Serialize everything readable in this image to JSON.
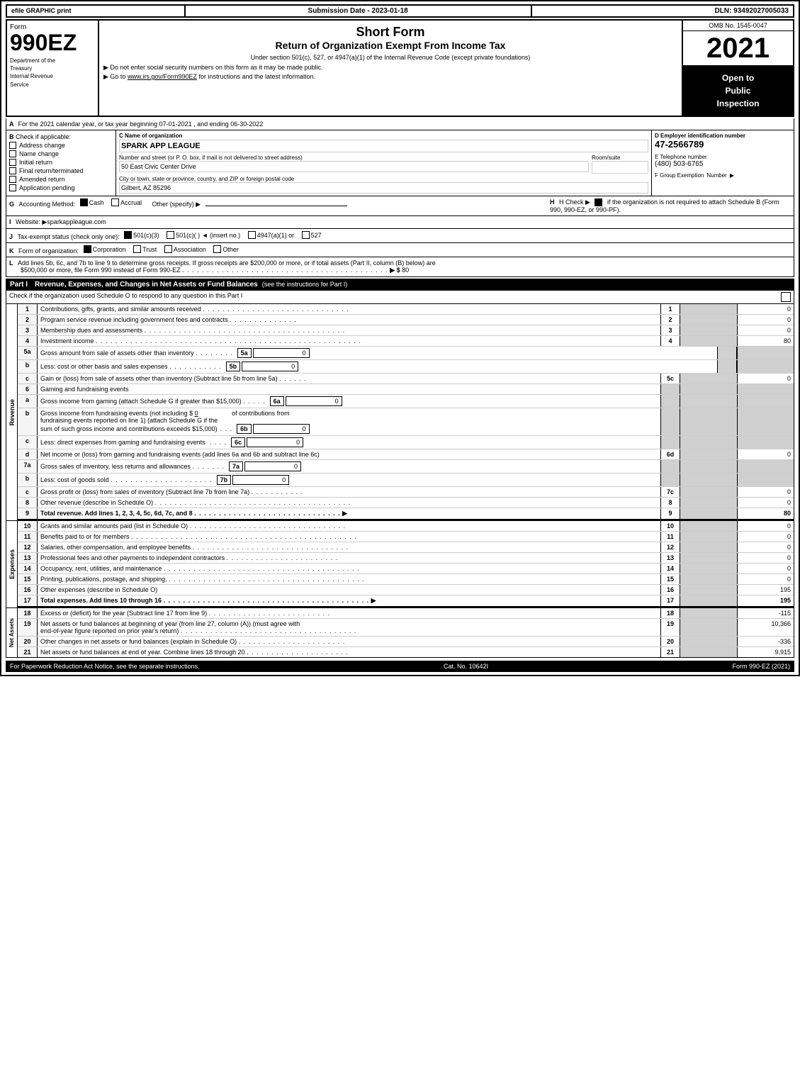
{
  "header": {
    "efile_label": "efile GRAPHIC print",
    "submission_label": "Submission Date - 2023-01-18",
    "dln_label": "DLN: 93492027005033",
    "form_number": "990EZ",
    "form_dept1": "Department of the",
    "form_dept2": "Treasury",
    "form_dept3": "Internal Revenue",
    "form_dept4": "Service",
    "short_form": "Short Form",
    "return_title": "Return of Organization Exempt From Income Tax",
    "under_section": "Under section 501(c), 527, or 4947(a)(1) of the Internal Revenue Code (except private foundations)",
    "do_not_enter": "▶ Do not enter social security numbers on this form as it may be made public.",
    "goto": "▶ Go to www.irs.gov/Form990EZ for instructions and the latest information.",
    "goto_url": "www.irs.gov/Form990EZ",
    "omb": "OMB No. 1545-0047",
    "year": "2021",
    "open_to_public": "Open to\nPublic\nInspection"
  },
  "section_a": {
    "label": "A",
    "text": "For the 2021 calendar year, or tax year beginning 07-01-2021 , and ending 06-30-2022"
  },
  "section_b": {
    "label": "B",
    "check_label": "Check if applicable:",
    "checkboxes": [
      {
        "label": "Address change",
        "checked": false
      },
      {
        "label": "Name change",
        "checked": false
      },
      {
        "label": "Initial return",
        "checked": false
      },
      {
        "label": "Final return/terminated",
        "checked": false
      },
      {
        "label": "Amended return",
        "checked": false
      },
      {
        "label": "Application pending",
        "checked": false
      }
    ],
    "c_label": "C Name of organization",
    "org_name": "SPARK APP LEAGUE",
    "address_label": "Number and street (or P. O. box, if mail is not delivered to street address)",
    "address_value": "50 East Civic Center Drive",
    "room_label": "Room/suite",
    "city_label": "City or town, state or province, country, and ZIP or foreign postal code",
    "city_value": "Gilbert, AZ  85296",
    "d_label": "D Employer identification number",
    "ein": "47-2566789",
    "e_label": "E Telephone number",
    "phone": "(480) 503-6765",
    "f_label": "F Group Exemption",
    "f_label2": "Number",
    "f_arrow": "▶"
  },
  "section_g": {
    "label": "G",
    "text": "Accounting Method:",
    "cash_label": "Cash",
    "cash_checked": true,
    "accrual_label": "Accrual",
    "accrual_checked": false,
    "other_label": "Other (specify) ▶",
    "h_text": "H  Check ▶",
    "h_checked": true,
    "h_detail": "if the organization is not required to attach Schedule B (Form 990, 990-EZ, or 990-PF)."
  },
  "section_i": {
    "label": "I",
    "text": "Website: ▶sparkappleague.com"
  },
  "section_j": {
    "label": "J",
    "text": "Tax-exempt status (check only one):",
    "options": [
      {
        "label": "501(c)(3)",
        "checked": true
      },
      {
        "label": "501(c)(  )  ◄ (insert no.)",
        "checked": false
      },
      {
        "label": "4947(a)(1) or",
        "checked": false
      },
      {
        "label": "527",
        "checked": false
      }
    ]
  },
  "section_k": {
    "label": "K",
    "text": "Form of organization:",
    "options": [
      {
        "label": "Corporation",
        "checked": true
      },
      {
        "label": "Trust",
        "checked": false
      },
      {
        "label": "Association",
        "checked": false
      },
      {
        "label": "Other",
        "checked": false
      }
    ]
  },
  "section_l": {
    "label": "L",
    "text1": "Add lines 5b, 6c, and 7b to line 9 to determine gross receipts. If gross receipts are $200,000 or more, or if total assets (Part II, column (B) below) are",
    "text2": "$500,000 or more, file Form 990 instead of Form 990-EZ",
    "dots": ". . . . . . . . . . . . . . . . . . . . . . . . . . . . . . . . . . . . .",
    "arrow": "▶ $",
    "value": "80"
  },
  "part1": {
    "title": "Part I",
    "subtitle": "Revenue, Expenses, and Changes in Net Assets or Fund Balances",
    "see_instructions": "(see the instructions for Part I)",
    "check_label": "Check if the organization used Schedule O to respond to any question in this Part I",
    "rows": [
      {
        "num": "1",
        "desc": "Contributions, gifts, grants, and similar amounts received",
        "dots": true,
        "col_num": "1",
        "value": "0"
      },
      {
        "num": "2",
        "desc": "Program service revenue including government fees and contracts",
        "dots": true,
        "col_num": "2",
        "value": "0"
      },
      {
        "num": "3",
        "desc": "Membership dues and assessments",
        "dots": true,
        "col_num": "3",
        "value": "0"
      },
      {
        "num": "4",
        "desc": "Investment income",
        "dots": true,
        "col_num": "4",
        "value": "80"
      },
      {
        "num": "5a",
        "desc": "Gross amount from sale of assets other than inventory",
        "sub_ref": "5a",
        "sub_val": "0",
        "col_num": "",
        "value": ""
      },
      {
        "num": "5b",
        "desc": "Less: cost or other basis and sales expenses",
        "sub_ref": "5b",
        "sub_val": "0",
        "col_num": "",
        "value": ""
      },
      {
        "num": "5c",
        "desc": "Gain or (loss) from sale of assets other than inventory (Subtract line 5b from line 5a)",
        "dots": true,
        "col_num": "5c",
        "value": "0"
      },
      {
        "num": "6",
        "desc": "Gaming and fundraising events",
        "col_num": "",
        "value": ""
      },
      {
        "num": "6a",
        "desc": "Gross income from gaming (attach Schedule G if greater than $15,000)",
        "sub_ref": "6a",
        "sub_val": "0",
        "col_num": "",
        "value": ""
      },
      {
        "num": "6b",
        "desc": "Gross income from fundraising events (not including $ 0 of contributions from fundraising events reported on line 1) (attach Schedule G if the sum of such gross income and contributions exceeds $15,000)",
        "sub_ref": "6b",
        "sub_val": "0",
        "col_num": "",
        "value": ""
      },
      {
        "num": "6c",
        "desc": "Less: direct expenses from gaming and fundraising events",
        "sub_ref": "6c",
        "sub_val": "0",
        "col_num": "",
        "value": ""
      },
      {
        "num": "6d",
        "desc": "Net income or (loss) from gaming and fundraising events (add lines 6a and 6b and subtract line 6c)",
        "col_num": "6d",
        "value": "0"
      },
      {
        "num": "7a",
        "desc": "Gross sales of inventory, less returns and allowances",
        "dots": true,
        "sub_ref": "7a",
        "sub_val": "0",
        "col_num": "",
        "value": ""
      },
      {
        "num": "7b",
        "desc": "Less: cost of goods sold",
        "dots": true,
        "sub_ref": "7b",
        "sub_val": "0",
        "col_num": "",
        "value": ""
      },
      {
        "num": "7c",
        "desc": "Gross profit or (loss) from sales of inventory (Subtract line 7b from line 7a)",
        "dots": true,
        "col_num": "7c",
        "value": "0"
      },
      {
        "num": "8",
        "desc": "Other revenue (describe in Schedule O)",
        "dots": true,
        "col_num": "8",
        "value": "0"
      },
      {
        "num": "9",
        "desc": "Total revenue. Add lines 1, 2, 3, 4, 5c, 6d, 7c, and 8",
        "dots": true,
        "arrow": "▶",
        "col_num": "9",
        "value": "80",
        "bold": true
      }
    ]
  },
  "expenses": {
    "rows": [
      {
        "num": "10",
        "desc": "Grants and similar amounts paid (list in Schedule O)",
        "dots": true,
        "col_num": "10",
        "value": "0"
      },
      {
        "num": "11",
        "desc": "Benefits paid to or for members",
        "dots": true,
        "col_num": "11",
        "value": "0"
      },
      {
        "num": "12",
        "desc": "Salaries, other compensation, and employee benefits",
        "dots": true,
        "col_num": "12",
        "value": "0"
      },
      {
        "num": "13",
        "desc": "Professional fees and other payments to independent contractors",
        "dots": true,
        "col_num": "13",
        "value": "0"
      },
      {
        "num": "14",
        "desc": "Occupancy, rent, utilities, and maintenance",
        "dots": true,
        "col_num": "14",
        "value": "0"
      },
      {
        "num": "15",
        "desc": "Printing, publications, postage, and shipping.",
        "dots": true,
        "col_num": "15",
        "value": "0"
      },
      {
        "num": "16",
        "desc": "Other expenses (describe in Schedule O)",
        "col_num": "16",
        "value": "195"
      },
      {
        "num": "17",
        "desc": "Total expenses. Add lines 10 through 16",
        "dots": true,
        "arrow": "▶",
        "col_num": "17",
        "value": "195",
        "bold": true
      }
    ]
  },
  "net_assets": {
    "rows": [
      {
        "num": "18",
        "desc": "Excess or (deficit) for the year (Subtract line 17 from line 9)",
        "dots": true,
        "col_num": "18",
        "value": "-115"
      },
      {
        "num": "19",
        "desc": "Net assets or fund balances at beginning of year (from line 27, column (A)) (must agree with end-of-year figure reported on prior year's return)",
        "dots": true,
        "col_num": "19",
        "value": "10,366"
      },
      {
        "num": "20",
        "desc": "Other changes in net assets or fund balances (explain in Schedule O)",
        "dots": true,
        "col_num": "20",
        "value": "-336"
      },
      {
        "num": "21",
        "desc": "Net assets or fund balances at end of year. Combine lines 18 through 20",
        "dots": true,
        "col_num": "21",
        "value": "9,915"
      }
    ]
  },
  "footer": {
    "left": "For Paperwork Reduction Act Notice, see the separate instructions.",
    "cat": "Cat. No. 10642I",
    "right": "Form 990-EZ (2021)"
  }
}
